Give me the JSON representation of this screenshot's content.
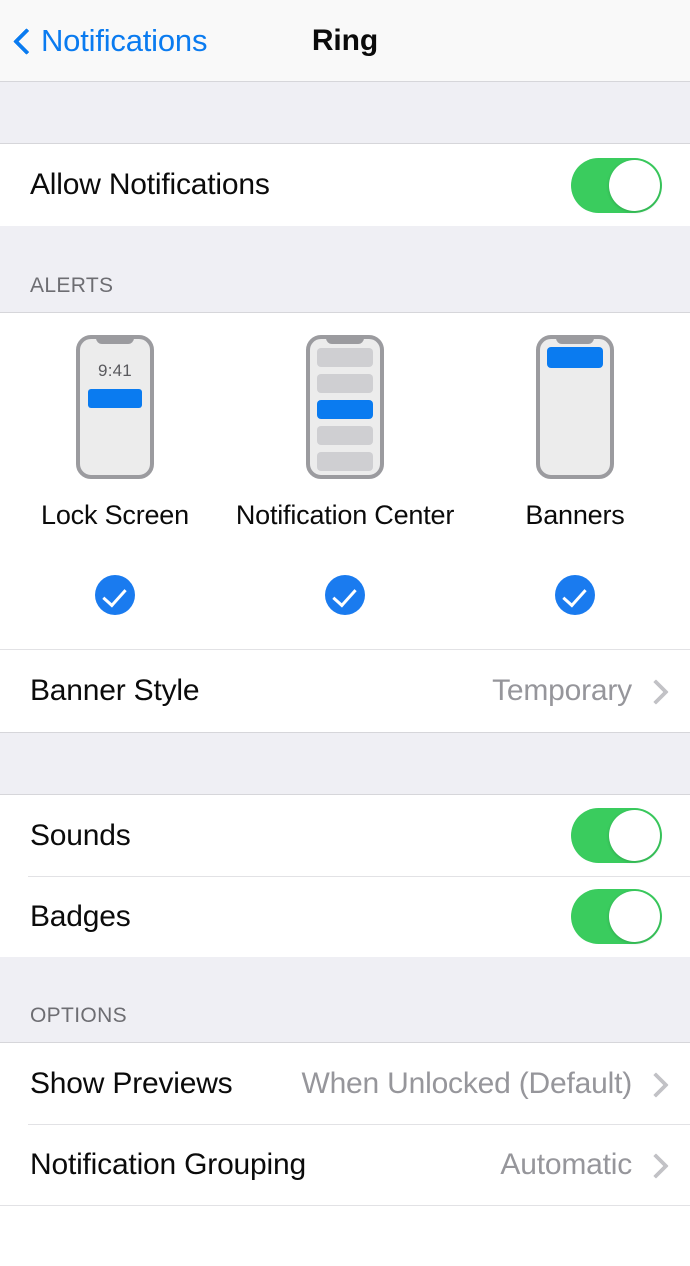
{
  "navbar": {
    "back_label": "Notifications",
    "back_icon": "chevron-left-icon",
    "title": "Ring"
  },
  "allow": {
    "label": "Allow Notifications",
    "toggle_on": true
  },
  "alerts": {
    "header": "ALERTS",
    "options": [
      {
        "label": "Lock Screen",
        "preview": "lock-screen",
        "time": "9:41",
        "selected": true
      },
      {
        "label": "Notification Center",
        "preview": "notification-center",
        "selected": true
      },
      {
        "label": "Banners",
        "preview": "banners",
        "selected": true
      }
    ],
    "banner_style": {
      "label": "Banner Style",
      "value": "Temporary",
      "chevron": "chevron-right-icon"
    }
  },
  "alerts_group2": {
    "rows": [
      {
        "label": "Sounds",
        "toggle_on": true
      },
      {
        "label": "Badges",
        "toggle_on": true
      }
    ]
  },
  "options": {
    "header": "OPTIONS",
    "rows": [
      {
        "label": "Show Previews",
        "value": "When Unlocked (Default)",
        "chevron": "chevron-right-icon"
      },
      {
        "label": "Notification Grouping",
        "value": "Automatic",
        "chevron": "chevron-right-icon"
      }
    ]
  },
  "colors": {
    "accent_blue": "#0a7bf0",
    "toggle_green": "#3acc5e",
    "check_blue": "#1a7bef",
    "group_bg": "#efeff4",
    "separator": "#d6d6da",
    "value_gray": "#96969b"
  }
}
